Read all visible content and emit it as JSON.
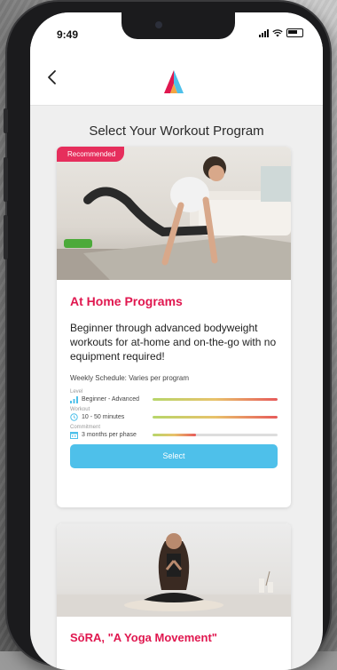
{
  "status": {
    "time": "9:49"
  },
  "header": {
    "back_icon": "chevron-left-icon",
    "logo": "brand-logo"
  },
  "page": {
    "title": "Select Your Workout Program"
  },
  "programs": [
    {
      "badge": "Recommended",
      "title": "At Home Programs",
      "description": "Beginner through advanced bodyweight workouts for at-home and on-the-go with no equipment required!",
      "schedule": "Weekly Schedule: Varies per program",
      "metrics": [
        {
          "label": "Level",
          "value": "Beginner - Advanced",
          "icon": "bar-chart-icon",
          "level": 1.0
        },
        {
          "label": "Workout",
          "value": "10 - 50 minutes",
          "icon": "clock-icon",
          "level": 1.0
        },
        {
          "label": "Commitment",
          "value": "3 months per phase",
          "icon": "calendar-icon",
          "level": 0.35
        }
      ],
      "select_label": "Select"
    },
    {
      "title": "SōRA, \"A Yoga Movement\""
    }
  ],
  "colors": {
    "accent": "#e0174f",
    "button": "#4ec0ea",
    "badge": "#e62e5c"
  }
}
